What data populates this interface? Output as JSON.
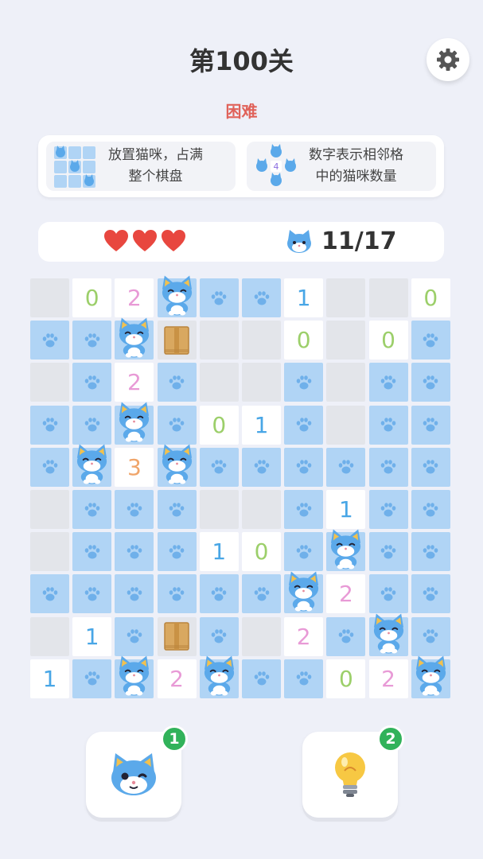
{
  "header": {
    "title": "第100关",
    "difficulty": "困难"
  },
  "rules": [
    {
      "text_line1": "放置猫咪，占满",
      "text_line2": "整个棋盘",
      "icon": "cat-grid-icon"
    },
    {
      "text_line1": "数字表示相邻格",
      "text_line2": "中的猫咪数量",
      "icon": "cat-neighbors-icon",
      "icon_number": "4"
    }
  ],
  "status": {
    "lives": 3,
    "cats_placed": "11/17"
  },
  "board": {
    "size": 10,
    "legend": "g=empty grey, p=paw tile (blue), c=cat, b=box, digits=number tiles",
    "rows": [
      [
        "g",
        "0",
        "2",
        "c",
        "p",
        "p",
        "1",
        "g",
        "g",
        "0"
      ],
      [
        "p",
        "p",
        "c",
        "b",
        "g",
        "g",
        "0",
        "g",
        "0",
        "p"
      ],
      [
        "g",
        "p",
        "2",
        "p",
        "g",
        "g",
        "p",
        "g",
        "p",
        "p"
      ],
      [
        "p",
        "p",
        "c",
        "p",
        "0",
        "1",
        "p",
        "g",
        "p",
        "p"
      ],
      [
        "p",
        "c",
        "3",
        "c",
        "p",
        "p",
        "p",
        "p",
        "p",
        "p"
      ],
      [
        "g",
        "p",
        "p",
        "p",
        "g",
        "g",
        "p",
        "1",
        "p",
        "p"
      ],
      [
        "g",
        "p",
        "p",
        "p",
        "1",
        "0",
        "p",
        "c",
        "p",
        "p"
      ],
      [
        "p",
        "p",
        "p",
        "p",
        "p",
        "p",
        "c",
        "2",
        "p",
        "p"
      ],
      [
        "g",
        "1",
        "p",
        "b",
        "p",
        "g",
        "2",
        "p",
        "c",
        "p"
      ],
      [
        "1",
        "p",
        "c",
        "2",
        "c",
        "p",
        "p",
        "0",
        "2",
        "c"
      ]
    ]
  },
  "actions": [
    {
      "name": "cat-wink-button",
      "icon": "cat-wink-icon",
      "badge": "1"
    },
    {
      "name": "hint-button",
      "icon": "lightbulb-icon",
      "badge": "2"
    }
  ],
  "colors": {
    "background": "#eef0f8",
    "difficulty": "#e0625a",
    "tile_blue": "#b0d4f5",
    "tile_grey": "#e3e5ea",
    "badge": "#31b25a",
    "heart": "#e8473f"
  }
}
